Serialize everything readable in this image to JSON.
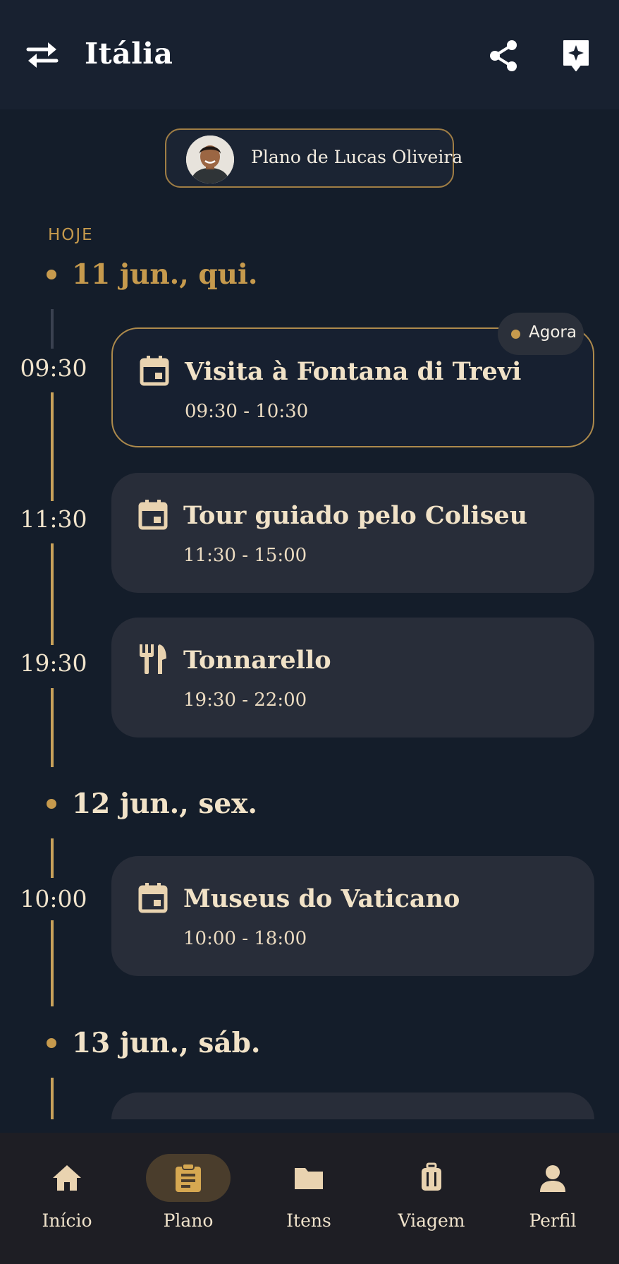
{
  "header": {
    "title": "Itália",
    "left_icon": "swap-arrows-icon",
    "right_icons": [
      "share-icon",
      "sparkle-bookmark-icon"
    ]
  },
  "owner_chip": {
    "label": "Plano de Lucas Oliveira",
    "avatar": "avatar"
  },
  "today_label": "HOJE",
  "days": [
    {
      "label": "11 jun., qui.",
      "events": [
        {
          "time": "09:30",
          "title": "Visita à Fontana di Trevi",
          "range": "09:30 - 10:30",
          "icon": "calendar-icon",
          "badge": "Agora"
        },
        {
          "time": "11:30",
          "title": "Tour guiado pelo Coliseu",
          "range": "11:30 - 15:00",
          "icon": "calendar-icon"
        },
        {
          "time": "19:30",
          "title": "Tonnarello",
          "range": "19:30 - 22:00",
          "icon": "restaurant-icon"
        }
      ]
    },
    {
      "label": "12 jun., sex.",
      "events": [
        {
          "time": "10:00",
          "title": "Museus do Vaticano",
          "range": "10:00 - 18:00",
          "icon": "calendar-icon"
        }
      ]
    },
    {
      "label": "13 jun., sáb.",
      "events": []
    }
  ],
  "nav": [
    {
      "label": "Início",
      "icon": "home-icon"
    },
    {
      "label": "Plano",
      "icon": "clipboard-icon",
      "active": true
    },
    {
      "label": "Itens",
      "icon": "folder-icon"
    },
    {
      "label": "Viagem",
      "icon": "luggage-icon"
    },
    {
      "label": "Perfil",
      "icon": "person-icon"
    }
  ],
  "colors": {
    "background": "#141d2a",
    "accent_gold": "#c69a4d",
    "card": "#282d39",
    "nav_bg": "#1e1e24"
  }
}
